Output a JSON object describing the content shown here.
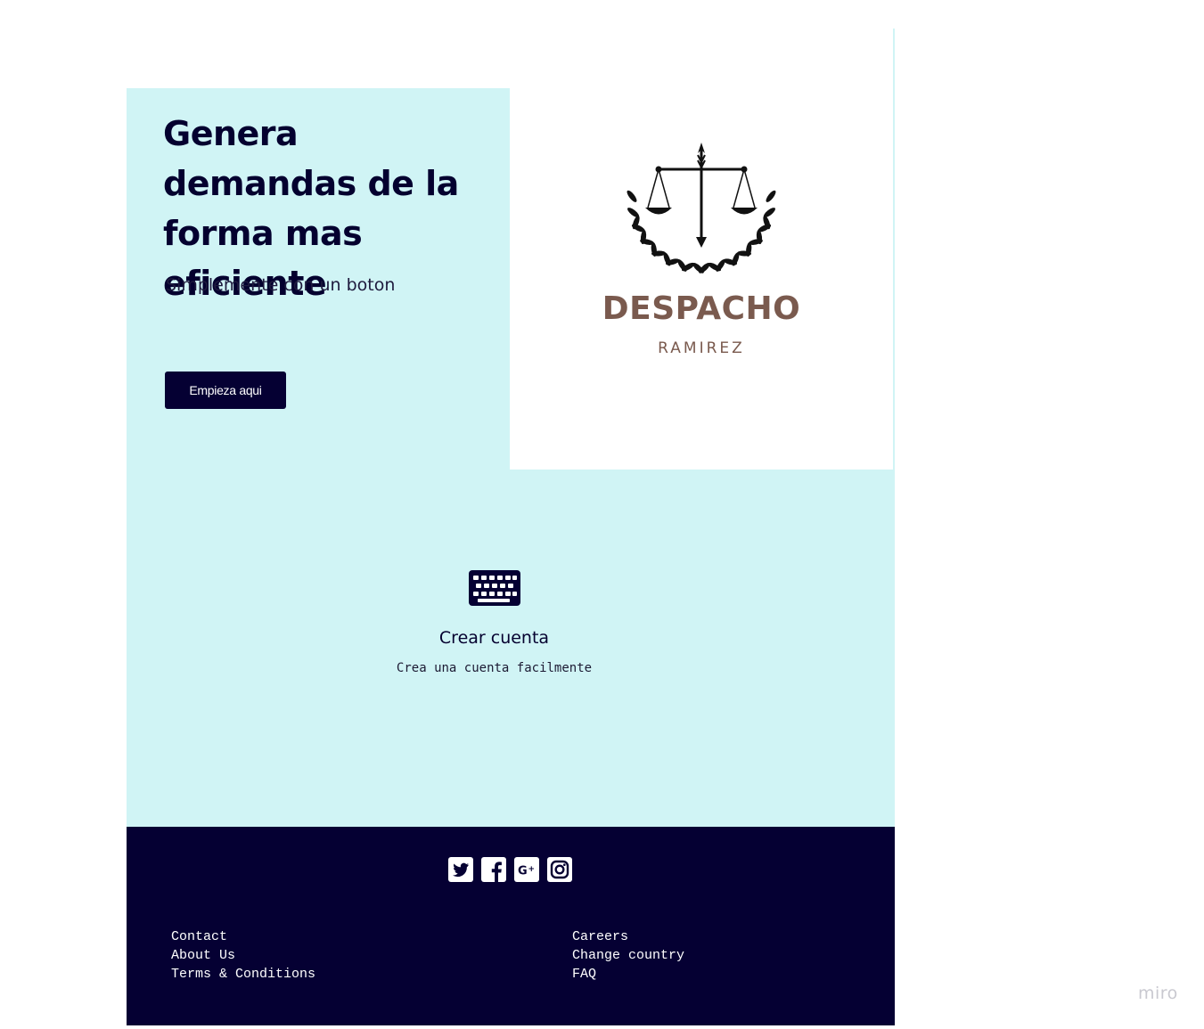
{
  "hero": {
    "title": "Genera demandas de la forma mas eficiente",
    "subtitle": "Simplemente con un boton",
    "cta_label": "Empieza aqui"
  },
  "logo": {
    "name": "DESPACHO",
    "subname": "RAMIREZ"
  },
  "feature": {
    "icon": "keyboard-icon",
    "title": "Crear cuenta",
    "description": "Crea una cuenta facilmente"
  },
  "footer": {
    "social": [
      "twitter-icon",
      "facebook-icon",
      "google-plus-icon",
      "instagram-icon"
    ],
    "left_links": [
      "Contact",
      "About Us",
      "Terms & Conditions"
    ],
    "right_links": [
      "Careers",
      "Change country",
      "FAQ"
    ]
  },
  "watermark": "miro",
  "colors": {
    "hero_bg": "#d0f4f5",
    "navy": "#050033",
    "logo_brown": "#7a5a4e"
  }
}
